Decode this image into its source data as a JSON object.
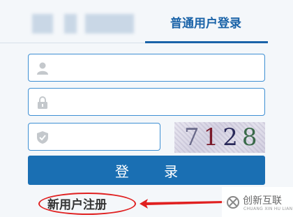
{
  "tabs": {
    "active_label": "普通用户登录"
  },
  "form": {
    "username_value": "",
    "password_value": "",
    "captcha_value": ""
  },
  "captcha": {
    "chars": [
      "7",
      "1",
      "2",
      "8"
    ]
  },
  "login_button": {
    "label": "登 录"
  },
  "register": {
    "label": "新用户注册"
  },
  "watermark": {
    "brand": "创新互联",
    "sub": "CHUANG XIN HU LIAN"
  },
  "colors": {
    "accent": "#1a63a8",
    "button": "#1a6fb3",
    "annotation": "#e02020"
  }
}
